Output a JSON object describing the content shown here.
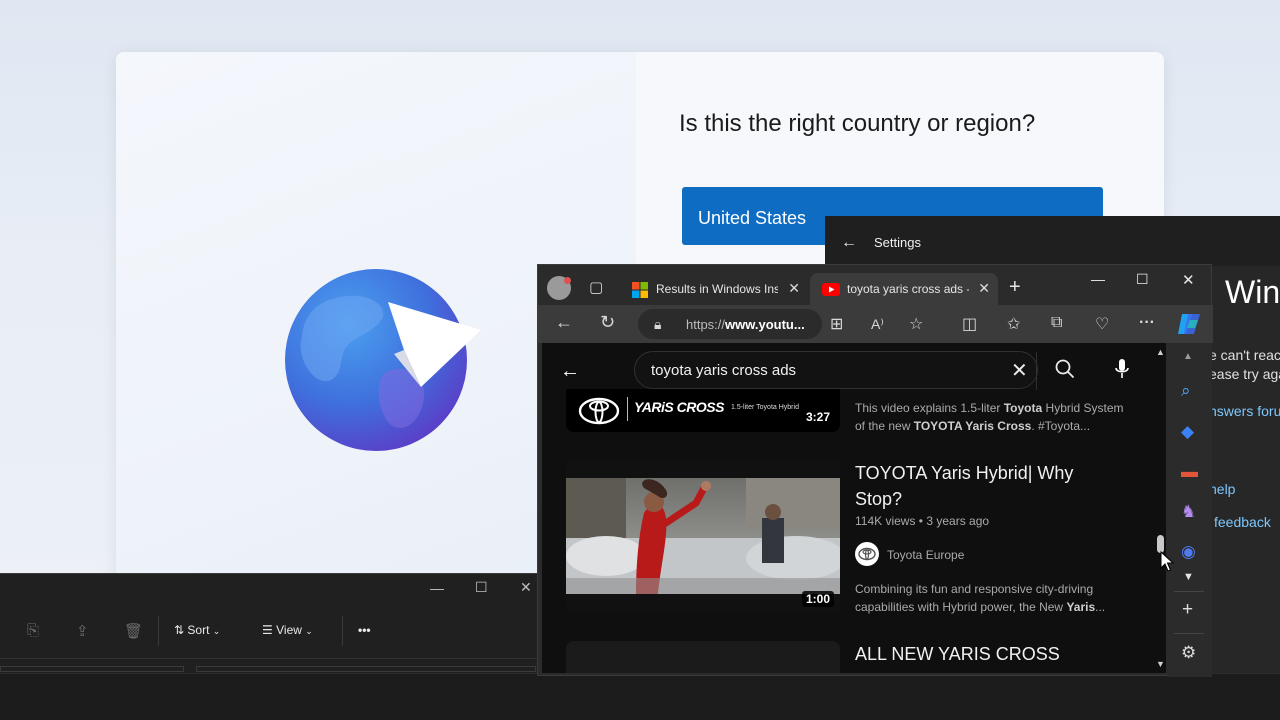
{
  "oobe": {
    "title": "Is this the right country or region?",
    "selected_country": "United States"
  },
  "settings": {
    "back_glyph": "←",
    "title": "Settings",
    "heading": "Win",
    "message_line1": "e can't reac",
    "message_line2": "ease try aga",
    "link_answers": "nswers foru",
    "link_help": "help",
    "link_feedback": "feedback"
  },
  "explorer": {
    "minimize": "—",
    "maximize": "☐",
    "close": "✕",
    "sort_label": "Sort",
    "view_label": "View",
    "more_label": "•••"
  },
  "edge": {
    "tabs": [
      {
        "label": "Results in Windows Insi",
        "icon": "microsoft-logo-icon"
      },
      {
        "label": "toyota yaris cross ads -",
        "icon": "youtube-icon"
      }
    ],
    "new_tab": "+",
    "address": {
      "prefix": "https://",
      "host": "www.youtu..."
    },
    "window": {
      "minimize": "—",
      "maximize": "☐",
      "close": "✕"
    }
  },
  "youtube": {
    "search_query": "toyota yaris cross ads",
    "videos": [
      {
        "thumb_brand": "YARiS CROSS",
        "thumb_sub": "1.5-liter Toyota Hybrid",
        "duration": "3:27",
        "desc_line1_pre": "This video explains 1.5-liter ",
        "desc_line1_bold": "Toyota",
        "desc_line1_post": " Hybrid System",
        "desc_line2_pre": "of the new ",
        "desc_line2_bold": "TOYOTA Yaris Cross",
        "desc_line2_post": ". #Toyota..."
      },
      {
        "title_line1": "TOYOTA Yaris Hybrid| Why",
        "title_line2": "Stop?",
        "meta": "114K views • 3 years ago",
        "channel": "Toyota Europe",
        "duration": "1:00",
        "desc_line1": "Combining its fun and responsive city-driving",
        "desc_line2_pre": "capabilities with Hybrid power, the New ",
        "desc_line2_bold": "Yaris",
        "desc_line2_post": "..."
      },
      {
        "title_line1": "ALL NEW YARIS CROSS"
      }
    ]
  },
  "colors": {
    "accent": "#0f6cc3",
    "youtube_red": "#ff0000",
    "link": "#7cc8ff"
  }
}
